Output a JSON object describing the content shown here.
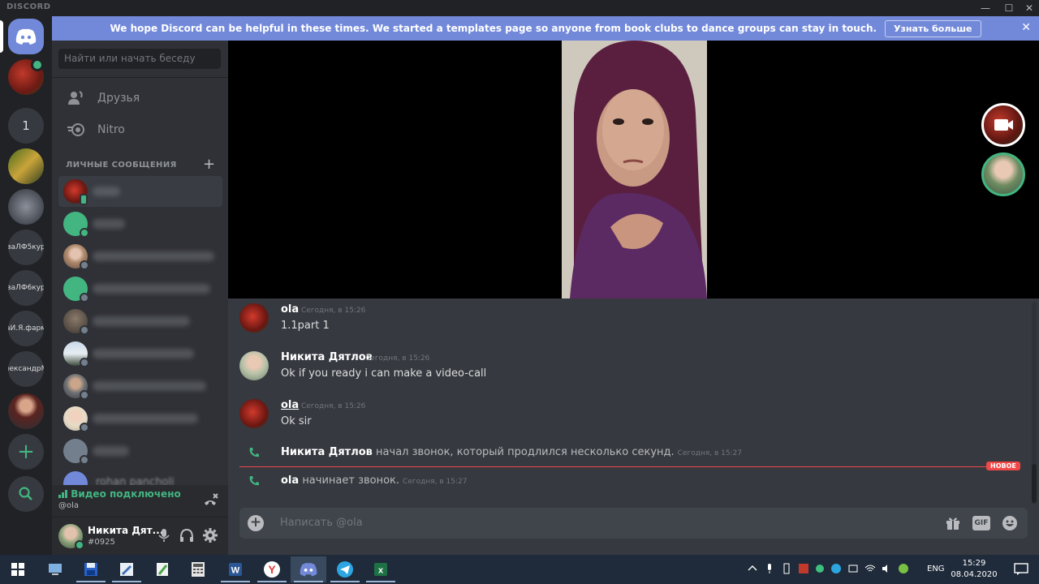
{
  "app": {
    "brand": "DISCORD",
    "window_controls": {
      "minimize": "—",
      "maximize": "☐",
      "close": "✕"
    }
  },
  "banner": {
    "text": "We hope Discord can be helpful in these times. We started a templates page so anyone from book clubs to dance groups can stay in touch.",
    "button": "Узнать больше",
    "close": "✕"
  },
  "servers": {
    "badge_count": "1",
    "labels": [
      "ваЛФ5кур",
      "ваЛФ6кур",
      "аИ.Я.фарм",
      "лександрМ"
    ],
    "add": "+",
    "colors": {
      "brand": "#7289da",
      "green": "#43b581"
    }
  },
  "sidebar": {
    "search_placeholder": "Найти или начать беседу",
    "nav": [
      {
        "label": "Друзья",
        "icon": "friends-icon"
      },
      {
        "label": "Nitro",
        "icon": "nitro-icon"
      }
    ],
    "dm_header": "ЛИЧНЫЕ СООБЩЕНИЯ",
    "dm_add": "+",
    "partial_dm_name": "rohan pancholi"
  },
  "voice": {
    "status": "Видео подключено",
    "channel": "@ola"
  },
  "user": {
    "name": "Никита Дят...",
    "tag": "#0925"
  },
  "messages": [
    {
      "author": "ola",
      "time": "Сегодня, в 15:26",
      "text": "1.1part 1"
    },
    {
      "author": "Никита Дятлов",
      "time": "Сегодня, в 15:26",
      "text": "Ok if you ready i can make a video-call"
    },
    {
      "author": "ola",
      "time": "Сегодня, в 15:26",
      "text": "Ok sir"
    }
  ],
  "system_messages": [
    {
      "author": "Никита Дятлов",
      "text": "начал звонок, который продлился несколько секунд.",
      "time": "Сегодня, в 15:27"
    },
    {
      "author": "ola",
      "text": "начинает звонок.",
      "time": "Сегодня, в 15:27"
    }
  ],
  "new_marker": "НОВОЕ",
  "composer": {
    "placeholder": "Написать @ola",
    "gif": "GIF"
  },
  "taskbar": {
    "lang": "ENG",
    "time": "15:29",
    "date": "08.04.2020",
    "notif_count": "1"
  }
}
